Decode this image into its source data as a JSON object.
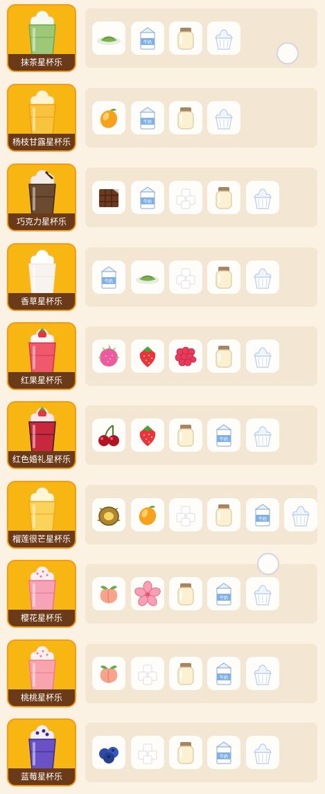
{
  "recipes": [
    {
      "name": "抹茶星杯乐",
      "drink": {
        "top": "#f5f9f0",
        "body": "#9cc877",
        "accent": "#6da84b",
        "decor": "none"
      },
      "ingredients": [
        "matcha-powder",
        "milk-carton",
        "pudding-jar",
        "whipped-cream"
      ]
    },
    {
      "name": "杨枝甘露星杯乐",
      "drink": {
        "top": "#fff4cf",
        "body": "#f9c43d",
        "accent": "#f39a14",
        "decor": "none"
      },
      "ingredients": [
        "mango",
        "milk-carton",
        "pudding-jar",
        "whipped-cream"
      ]
    },
    {
      "name": "巧克力星杯乐",
      "drink": {
        "top": "#f3ece6",
        "body": "#6b4a32",
        "accent": "#3e2616",
        "decor": "chocolate"
      },
      "ingredients": [
        "chocolate-bar",
        "milk-carton",
        "sugar-cubes",
        "pudding-jar",
        "whipped-cream"
      ]
    },
    {
      "name": "香草星杯乐",
      "drink": {
        "top": "#ffffff",
        "body": "#f7f4ef",
        "accent": "#eee8df",
        "decor": "none"
      },
      "ingredients": [
        "milk-carton",
        "matcha-powder",
        "sugar-cubes",
        "pudding-jar",
        "whipped-cream"
      ]
    },
    {
      "name": "红果星杯乐",
      "drink": {
        "top": "#fff5f6",
        "body": "#f0596b",
        "accent": "#d5314a",
        "decor": "strawberry"
      },
      "ingredients": [
        "dragon-fruit",
        "strawberry",
        "raspberry",
        "pudding-jar",
        "whipped-cream"
      ]
    },
    {
      "name": "红色婚礼星杯乐",
      "drink": {
        "top": "#fde7ea",
        "body": "#c8283b",
        "accent": "#3a1a2c",
        "decor": "strawberry"
      },
      "ingredients": [
        "cherry",
        "strawberry",
        "pudding-jar",
        "milk-carton",
        "whipped-cream"
      ]
    },
    {
      "name": "榴莲很芒星杯乐",
      "drink": {
        "top": "#fff6d6",
        "body": "#fbd35a",
        "accent": "#f2a51c",
        "decor": "none"
      },
      "ingredients": [
        "durian",
        "mango",
        "sugar-cubes",
        "pudding-jar",
        "milk-carton",
        "whipped-cream"
      ]
    },
    {
      "name": "樱花星杯乐",
      "drink": {
        "top": "#fdeef2",
        "body": "#f6a2b7",
        "accent": "#ee6f8f",
        "decor": "sprinkles"
      },
      "ingredients": [
        "peach",
        "sakura",
        "pudding-jar",
        "milk-carton",
        "whipped-cream"
      ]
    },
    {
      "name": "桃桃星杯乐",
      "drink": {
        "top": "#fff0f0",
        "body": "#f7a4ae",
        "accent": "#ef7c8a",
        "decor": "sprinkles"
      },
      "ingredients": [
        "peach",
        "sugar-cubes",
        "pudding-jar",
        "milk-carton",
        "whipped-cream"
      ]
    },
    {
      "name": "蓝莓星杯乐",
      "drink": {
        "top": "#f1edf9",
        "body": "#6a52c6",
        "accent": "#3a2a8a",
        "decor": "blueberry"
      },
      "ingredients": [
        "blueberry",
        "sugar-cubes",
        "pudding-jar",
        "milk-carton",
        "whipped-cream"
      ]
    }
  ]
}
